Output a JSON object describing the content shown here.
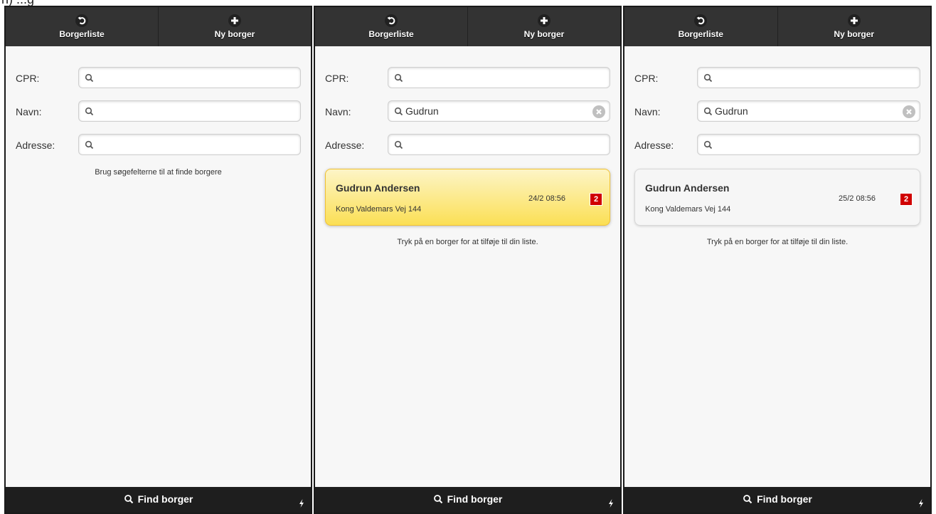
{
  "nav": {
    "back_label": "Borgerliste",
    "new_label": "Ny borger"
  },
  "form": {
    "cpr_label": "CPR:",
    "navn_label": "Navn:",
    "adresse_label": "Adresse:"
  },
  "footer": {
    "find_label": "Find borger"
  },
  "panels": [
    {
      "cpr_value": "",
      "navn_value": "",
      "adresse_value": "",
      "hint": "Brug søgefelterne til at finde borgere"
    },
    {
      "cpr_value": "",
      "navn_value": "Gudrun",
      "adresse_value": "",
      "result": {
        "name": "Gudrun Andersen",
        "address": "Kong Valdemars Vej 144",
        "time": "24/2 08:56",
        "badge": "2",
        "style": "highlighted-yellow"
      },
      "hint": "Tryk på en borger for at tilføje til din liste."
    },
    {
      "cpr_value": "",
      "navn_value": "Gudrun",
      "adresse_value": "",
      "result": {
        "name": "Gudrun Andersen",
        "address": "Kong Valdemars Vej 144",
        "time": "25/2 08:56",
        "badge": "2",
        "style": "plain"
      },
      "hint": "Tryk på en borger for at tilføje til din liste."
    }
  ],
  "colors": {
    "navbar": "#333333",
    "footer": "#1e1e1e",
    "badge": "#d00000",
    "highlight": "#fbdf55",
    "background": "#f7f7f7"
  },
  "icons": {
    "back": "undo-icon",
    "new": "plus-icon",
    "search": "search-icon",
    "clear": "clear-icon",
    "bolt": "bolt-icon"
  }
}
